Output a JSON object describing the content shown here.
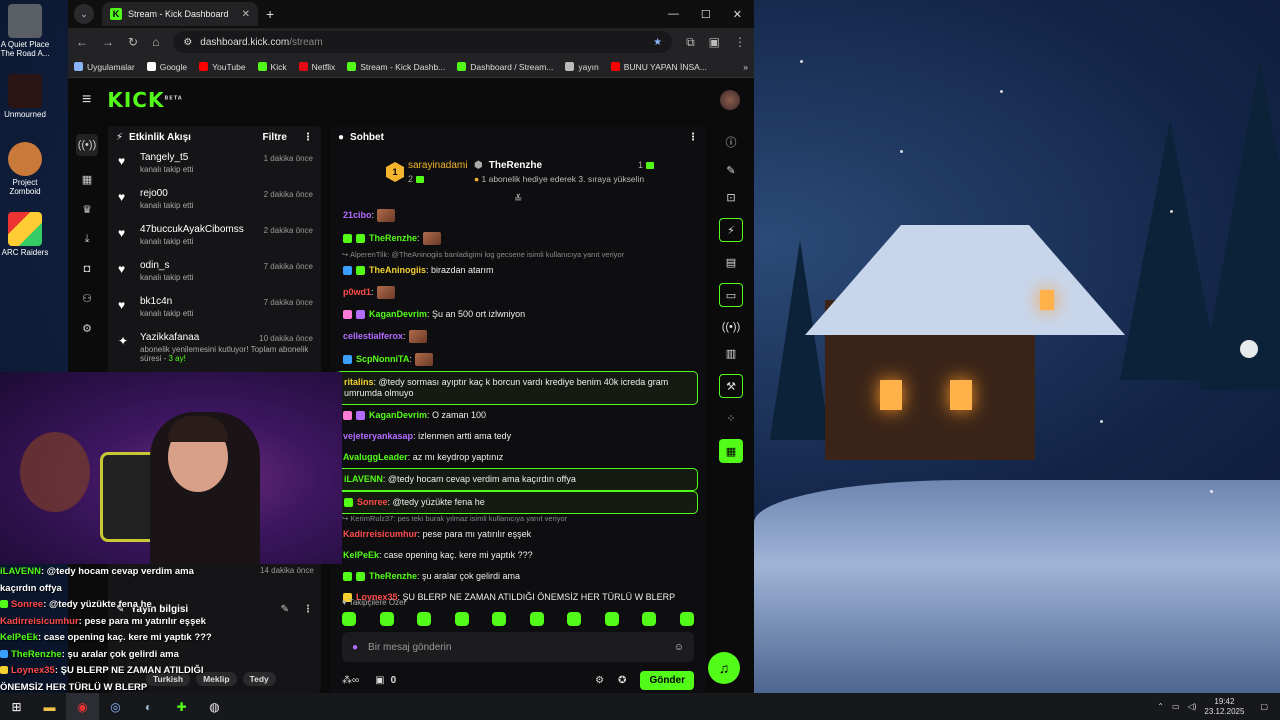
{
  "browser": {
    "tab_title": "Stream - Kick Dashboard",
    "url_host": "dashboard.kick.com",
    "url_path": "/stream",
    "bookmarks": [
      {
        "label": "Uygulamalar",
        "color": "#8ab4f8"
      },
      {
        "label": "Google",
        "color": "#ffffff"
      },
      {
        "label": "YouTube",
        "color": "#ff0000"
      },
      {
        "label": "Kick",
        "color": "#53fc18"
      },
      {
        "label": "Netflix",
        "color": "#e50914"
      },
      {
        "label": "Stream - Kick Dashb...",
        "color": "#53fc18"
      },
      {
        "label": "Dashboard / Stream...",
        "color": "#53fc18"
      },
      {
        "label": "yayın",
        "color": "#bbbbbb"
      },
      {
        "label": "BUNU YAPAN İNSA...",
        "color": "#ff0000"
      }
    ]
  },
  "desktop_icons": [
    {
      "label": "A Quiet Place The Road A..."
    },
    {
      "label": "Unmourned"
    },
    {
      "label": "Project Zomboid"
    },
    {
      "label": "ARC Raiders"
    }
  ],
  "activity": {
    "title": "Etkinlik Akışı",
    "filter": "Filtre",
    "items": [
      {
        "user": "Tangely_t5",
        "sub": "kanalı takip etti",
        "time": "1 dakika önce"
      },
      {
        "user": "rejo00",
        "sub": "kanalı takip etti",
        "time": "2 dakika önce"
      },
      {
        "user": "47buccukAyakCibomss",
        "sub": "kanalı takip etti",
        "time": "2 dakika önce"
      },
      {
        "user": "odin_s",
        "sub": "kanalı takip etti",
        "time": "7 dakika önce"
      },
      {
        "user": "bk1c4n",
        "sub": "kanalı takip etti",
        "time": "7 dakika önce"
      }
    ],
    "resub": {
      "user": "Yazikkafanaa",
      "time": "10 dakika önce",
      "text_a": "abonelik yenilemesini kutluyor! Toplam abonelik süresi - ",
      "months": "3 ay!"
    },
    "ghost_time": "14 dakika önce"
  },
  "stream_info": {
    "title": "Yayın bilgisi",
    "tags": [
      "Turkish",
      "Meklip",
      "Tedy"
    ]
  },
  "overlay_chat": [
    {
      "user": "iLAVENN",
      "text": ": @tedy hocam cevap verdim ama kaçırdın offya",
      "color": "#53fc18",
      "badge": ""
    },
    {
      "user": "Sonree",
      "text": ": @tedy yüzükte fena he",
      "color": "#ff4b4b",
      "badge": "#53fc18"
    },
    {
      "user": "Kadirreisicumhur",
      "text": ": pese para mı yatırılır eşşek",
      "color": "#ff4b4b",
      "badge": ""
    },
    {
      "user": "KelPeEk",
      "text": ": case opening kaç. kere mi yaptık ???",
      "color": "#53fc18",
      "badge": ""
    },
    {
      "user": "TheRenzhe",
      "text": ": şu aralar çok gelirdi ama",
      "color": "#53fc18",
      "badge": "#3aa0ff"
    },
    {
      "user": "Loynex35",
      "text": ": ŞU BLERP NE ZAMAN ATILDIĞI ÖNEMSİZ HER TÜRLÜ W BLERP",
      "color": "#ff4b4b",
      "badge": "#f3d02f"
    }
  ],
  "chat": {
    "title": "Sohbet",
    "pinned": {
      "rank": "1",
      "user1": "sarayinadami",
      "user1_count": "2",
      "user2": "TheRenzhe",
      "desc": "1 abonelik hediye ederek 3. sıraya yükselin",
      "user2_count": "1"
    },
    "messages": [
      {
        "user": "21cibo",
        "text": ":",
        "color": "#b36cff",
        "emote": true,
        "hl": false
      },
      {
        "user": "TheRenzhe",
        "text": ":",
        "color": "#53fc18",
        "emote": true,
        "hl": false,
        "badges": [
          "#53fc18",
          "#53fc18"
        ]
      },
      {
        "reply": "AlperenTilk: @TheAninogiis banladigimi log gecsene isimli kullanıcıya yanıt veriyor"
      },
      {
        "user": "TheAninogiis",
        "text": ": birazdan atarım",
        "color": "#f3d02f",
        "badges": [
          "#3aa0ff",
          "#53fc18"
        ]
      },
      {
        "user": "p0wd1",
        "text": ":",
        "color": "#ff4b4b",
        "emote": true
      },
      {
        "user": "KaganDevrim",
        "text": ": Şu an 500 ort izlwniyon",
        "color": "#53fc18",
        "badges": [
          "#ff7bd8",
          "#b36cff"
        ]
      },
      {
        "user": "cellestialferox",
        "text": ":",
        "color": "#b36cff",
        "emote": true
      },
      {
        "user": "ScpNonniTA",
        "text": ":",
        "color": "#53fc18",
        "emote": true,
        "badges": [
          "#3aa0ff"
        ]
      },
      {
        "user": "ritalins",
        "text": ": @tedy sorması ayıptır kaç k borcun vardı krediye benim 40k icreda gram umrumda olmuyo",
        "color": "#f3d02f",
        "hl": true
      },
      {
        "user": "KaganDevrim",
        "text": ": O zaman 100",
        "color": "#53fc18",
        "badges": [
          "#ff7bd8",
          "#b36cff"
        ]
      },
      {
        "user": "vejeteryankasap",
        "text": ": izlenmen artti ama tedy",
        "color": "#b36cff"
      },
      {
        "user": "AvaluggLeader",
        "text": ": az mı keydrop yaptınız",
        "color": "#53fc18"
      },
      {
        "user": "iLAVENN",
        "text": ": @tedy hocam cevap verdim ama kaçırdın offya",
        "color": "#53fc18",
        "hl": true
      },
      {
        "user": "Sonree",
        "text": ": @tedy yüzükte fena he",
        "color": "#ff4b4b",
        "hl": true,
        "badges": [
          "#53fc18"
        ]
      },
      {
        "reply": "KerimRulz37: pes teki burak yılmaz isimli kullanıcıya yanıt veriyor"
      },
      {
        "user": "Kadirreisicumhur",
        "text": ": pese para mı yatırılır eşşek",
        "color": "#ff4b4b"
      },
      {
        "user": "KelPeEk",
        "text": ": case opening kaç. kere mi yaptık ???",
        "color": "#53fc18"
      },
      {
        "user": "TheRenzhe",
        "text": ": şu aralar çok gelirdi ama",
        "color": "#53fc18",
        "badges": [
          "#53fc18",
          "#53fc18"
        ]
      },
      {
        "user": "Loynex35",
        "text": ": ŞU BLERP NE ZAMAN ATILDIĞI ÖNEMSİZ HER TÜRLÜ W BLERP",
        "color": "#ff4b4b",
        "badges": [
          "#f3d02f"
        ]
      }
    ],
    "follower_label": "Takipçilere Özel",
    "input_placeholder": "Bir mesaj gönderin",
    "points": "0",
    "send_label": "Gönder"
  },
  "taskbar": {
    "time": "19:42",
    "date": "23.12.2025"
  },
  "colors": {
    "accent": "#53fc18",
    "panel": "#151517",
    "chat_bg": "#0e0e10"
  }
}
